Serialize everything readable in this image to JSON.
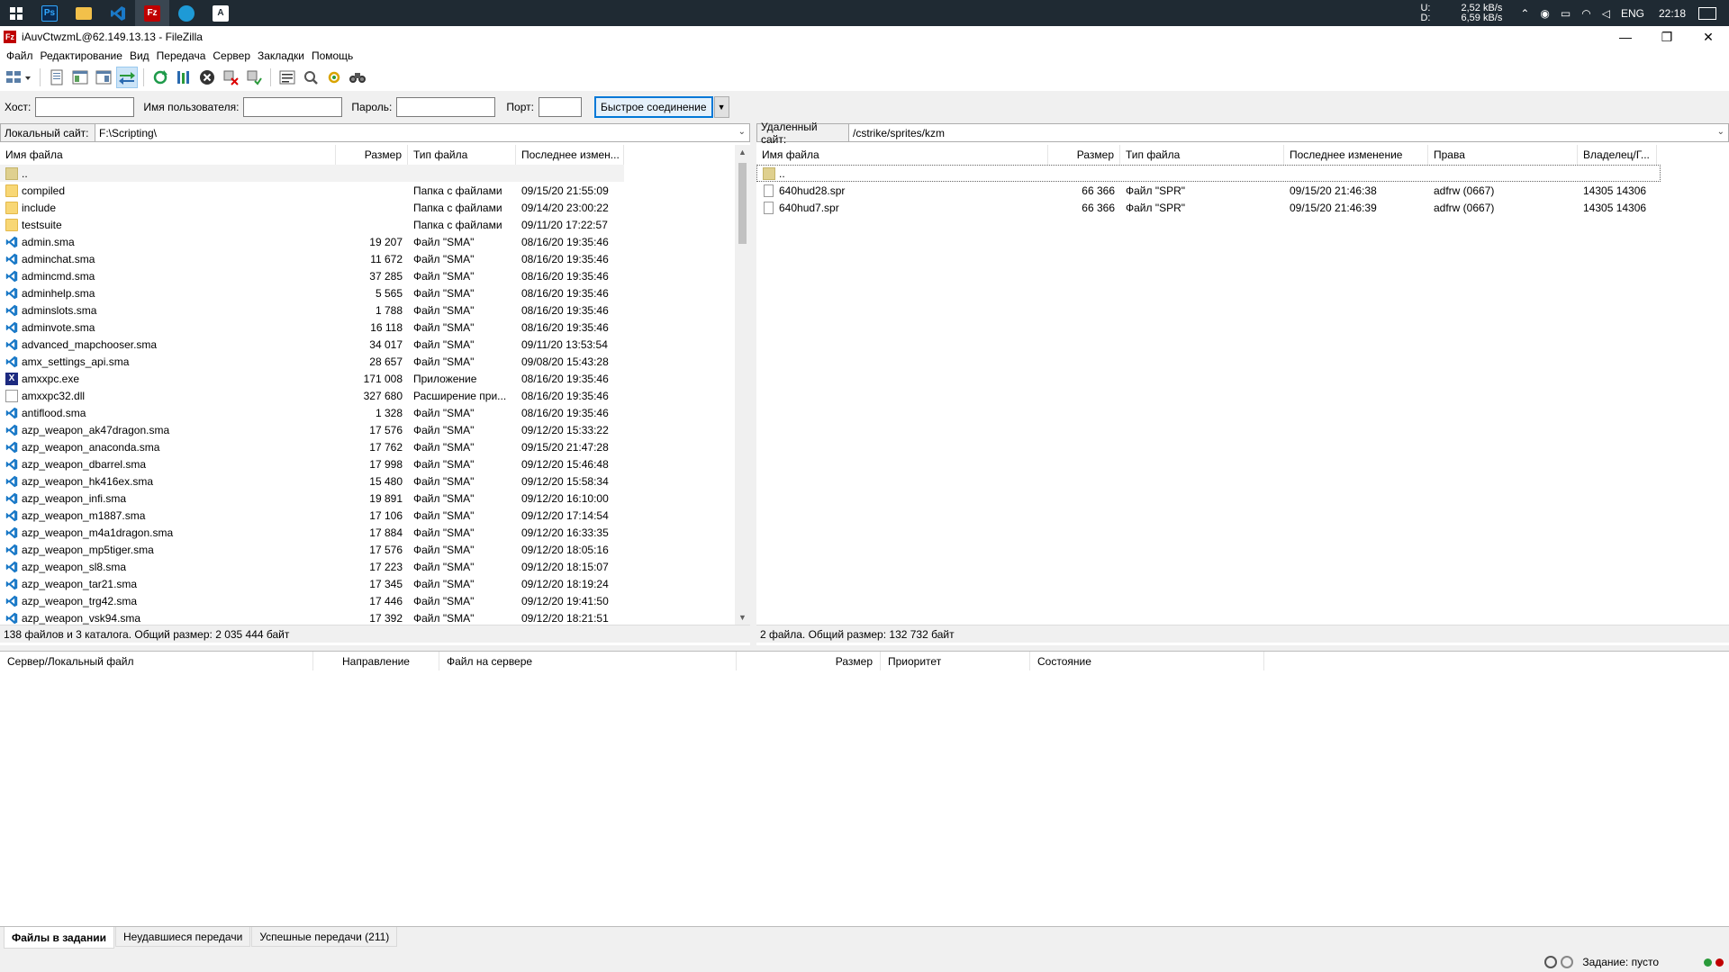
{
  "taskbar": {
    "apps": [
      {
        "name": "photoshop",
        "label": "Ps",
        "color": "#0b2a4f"
      },
      {
        "name": "explorer",
        "label": "",
        "color": "#f2c04a"
      },
      {
        "name": "vscode",
        "label": "",
        "color": "#1a79c7"
      },
      {
        "name": "filezilla",
        "label": "Fz",
        "color": "#bf0000"
      },
      {
        "name": "edge",
        "label": "",
        "color": "#1e9ad6"
      },
      {
        "name": "app",
        "label": "",
        "color": "#ffffff"
      }
    ],
    "net_u_label": "U:",
    "net_d_label": "D:",
    "net_u": "2,52 kB/s",
    "net_d": "6,59 kB/s",
    "lang": "ENG",
    "time": "22:18"
  },
  "window": {
    "title": "iAuvCtwzmL@62.149.13.13 - FileZilla"
  },
  "menu": [
    "Файл",
    "Редактирование",
    "Вид",
    "Передача",
    "Сервер",
    "Закладки",
    "Помощь"
  ],
  "quick": {
    "host_label": "Хост:",
    "user_label": "Имя пользователя:",
    "pass_label": "Пароль:",
    "port_label": "Порт:",
    "host_value": "",
    "user_value": "",
    "pass_value": "",
    "port_value": "",
    "connect_label": "Быстрое соединение"
  },
  "local": {
    "site_label": "Локальный сайт:",
    "path": "F:\\Scripting\\",
    "columns": [
      "Имя файла",
      "Размер",
      "Тип файла",
      "Последнее измен..."
    ],
    "rows": [
      {
        "icon": "up",
        "name": "..",
        "size": "",
        "type": "",
        "modified": ""
      },
      {
        "icon": "folder",
        "name": "compiled",
        "size": "",
        "type": "Папка с файлами",
        "modified": "09/15/20 21:55:09"
      },
      {
        "icon": "folder",
        "name": "include",
        "size": "",
        "type": "Папка с файлами",
        "modified": "09/14/20 23:00:22"
      },
      {
        "icon": "folder",
        "name": "testsuite",
        "size": "",
        "type": "Папка с файлами",
        "modified": "09/11/20 17:22:57"
      },
      {
        "icon": "sma",
        "name": "admin.sma",
        "size": "19 207",
        "type": "Файл \"SMA\"",
        "modified": "08/16/20 19:35:46"
      },
      {
        "icon": "sma",
        "name": "adminchat.sma",
        "size": "11 672",
        "type": "Файл \"SMA\"",
        "modified": "08/16/20 19:35:46"
      },
      {
        "icon": "sma",
        "name": "admincmd.sma",
        "size": "37 285",
        "type": "Файл \"SMA\"",
        "modified": "08/16/20 19:35:46"
      },
      {
        "icon": "sma",
        "name": "adminhelp.sma",
        "size": "5 565",
        "type": "Файл \"SMA\"",
        "modified": "08/16/20 19:35:46"
      },
      {
        "icon": "sma",
        "name": "adminslots.sma",
        "size": "1 788",
        "type": "Файл \"SMA\"",
        "modified": "08/16/20 19:35:46"
      },
      {
        "icon": "sma",
        "name": "adminvote.sma",
        "size": "16 118",
        "type": "Файл \"SMA\"",
        "modified": "08/16/20 19:35:46"
      },
      {
        "icon": "sma",
        "name": "advanced_mapchooser.sma",
        "size": "34 017",
        "type": "Файл \"SMA\"",
        "modified": "09/11/20 13:53:54"
      },
      {
        "icon": "sma",
        "name": "amx_settings_api.sma",
        "size": "28 657",
        "type": "Файл \"SMA\"",
        "modified": "09/08/20 15:43:28"
      },
      {
        "icon": "exe",
        "name": "amxxpc.exe",
        "size": "171 008",
        "type": "Приложение",
        "modified": "08/16/20 19:35:46"
      },
      {
        "icon": "dll",
        "name": "amxxpc32.dll",
        "size": "327 680",
        "type": "Расширение при...",
        "modified": "08/16/20 19:35:46"
      },
      {
        "icon": "sma",
        "name": "antiflood.sma",
        "size": "1 328",
        "type": "Файл \"SMA\"",
        "modified": "08/16/20 19:35:46"
      },
      {
        "icon": "sma",
        "name": "azp_weapon_ak47dragon.sma",
        "size": "17 576",
        "type": "Файл \"SMA\"",
        "modified": "09/12/20 15:33:22"
      },
      {
        "icon": "sma",
        "name": "azp_weapon_anaconda.sma",
        "size": "17 762",
        "type": "Файл \"SMA\"",
        "modified": "09/15/20 21:47:28"
      },
      {
        "icon": "sma",
        "name": "azp_weapon_dbarrel.sma",
        "size": "17 998",
        "type": "Файл \"SMA\"",
        "modified": "09/12/20 15:46:48"
      },
      {
        "icon": "sma",
        "name": "azp_weapon_hk416ex.sma",
        "size": "15 480",
        "type": "Файл \"SMA\"",
        "modified": "09/12/20 15:58:34"
      },
      {
        "icon": "sma",
        "name": "azp_weapon_infi.sma",
        "size": "19 891",
        "type": "Файл \"SMA\"",
        "modified": "09/12/20 16:10:00"
      },
      {
        "icon": "sma",
        "name": "azp_weapon_m1887.sma",
        "size": "17 106",
        "type": "Файл \"SMA\"",
        "modified": "09/12/20 17:14:54"
      },
      {
        "icon": "sma",
        "name": "azp_weapon_m4a1dragon.sma",
        "size": "17 884",
        "type": "Файл \"SMA\"",
        "modified": "09/12/20 16:33:35"
      },
      {
        "icon": "sma",
        "name": "azp_weapon_mp5tiger.sma",
        "size": "17 576",
        "type": "Файл \"SMA\"",
        "modified": "09/12/20 18:05:16"
      },
      {
        "icon": "sma",
        "name": "azp_weapon_sl8.sma",
        "size": "17 223",
        "type": "Файл \"SMA\"",
        "modified": "09/12/20 18:15:07"
      },
      {
        "icon": "sma",
        "name": "azp_weapon_tar21.sma",
        "size": "17 345",
        "type": "Файл \"SMA\"",
        "modified": "09/12/20 18:19:24"
      },
      {
        "icon": "sma",
        "name": "azp_weapon_trg42.sma",
        "size": "17 446",
        "type": "Файл \"SMA\"",
        "modified": "09/12/20 19:41:50"
      },
      {
        "icon": "sma",
        "name": "azp_weapon_vsk94.sma",
        "size": "17 392",
        "type": "Файл \"SMA\"",
        "modified": "09/12/20 18:21:51"
      }
    ],
    "status": "138 файлов и 3 каталога. Общий размер: 2 035 444 байт"
  },
  "remote": {
    "site_label": "Удаленный сайт:",
    "path": "/cstrike/sprites/kzm",
    "columns": [
      "Имя файла",
      "Размер",
      "Тип файла",
      "Последнее изменение",
      "Права",
      "Владелец/Г..."
    ],
    "rows": [
      {
        "icon": "up",
        "name": "..",
        "size": "",
        "type": "",
        "modified": "",
        "perms": "",
        "owner": ""
      },
      {
        "icon": "file",
        "name": "640hud28.spr",
        "size": "66 366",
        "type": "Файл \"SPR\"",
        "modified": "09/15/20 21:46:38",
        "perms": "adfrw (0667)",
        "owner": "14305 14306"
      },
      {
        "icon": "file",
        "name": "640hud7.spr",
        "size": "66 366",
        "type": "Файл \"SPR\"",
        "modified": "09/15/20 21:46:39",
        "perms": "adfrw (0667)",
        "owner": "14305 14306"
      }
    ],
    "status": "2 файла. Общий размер: 132 732 байт"
  },
  "queue": {
    "columns": [
      "Сервер/Локальный файл",
      "Направление",
      "Файл на сервере",
      "Размер",
      "Приоритет",
      "Состояние"
    ]
  },
  "tabs": [
    "Файлы в задании",
    "Неудавшиеся передачи",
    "Успешные передачи (211)"
  ],
  "statusbar": {
    "queue_text": "Задание: пусто"
  }
}
